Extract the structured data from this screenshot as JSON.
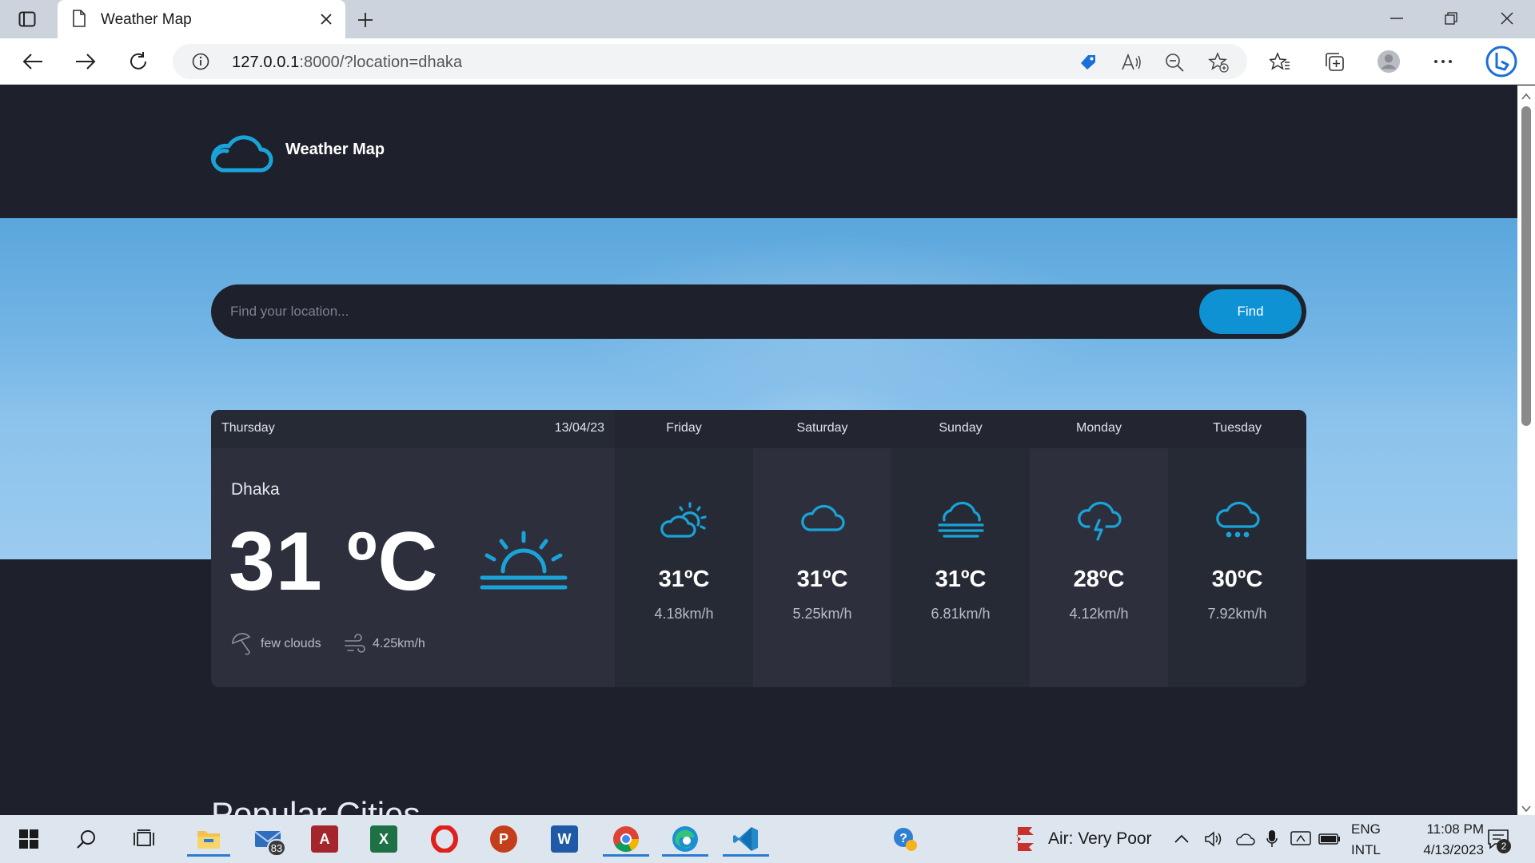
{
  "browser": {
    "tab_title": "Weather Map",
    "url_host": "127.0.0.1",
    "url_rest": ":8000/?location=dhaka",
    "icons": [
      "tab-actions-icon",
      "page-icon",
      "close-icon",
      "plus-icon",
      "minimize-icon",
      "restore-icon",
      "close-window-icon",
      "back-icon",
      "forward-icon",
      "refresh-icon",
      "info-icon",
      "coupon-tag-icon",
      "read-aloud-icon",
      "zoom-out-icon",
      "add-favorite-icon",
      "favorites-icon",
      "collections-icon",
      "profile-icon",
      "more-icon",
      "bing-icon"
    ]
  },
  "site": {
    "name": "Weather Map",
    "accent_color": "#1aa3d9"
  },
  "search": {
    "placeholder": "Find your location...",
    "button": "Find"
  },
  "today": {
    "day": "Thursday",
    "date": "13/04/23",
    "city": "Dhaka",
    "temp": "31 ºC",
    "description": "few clouds",
    "wind": "4.25km/h",
    "icon": "sunrise-icon"
  },
  "forecast": [
    {
      "day": "Friday",
      "temp": "31ºC",
      "wind": "4.18km/h",
      "icon": "partly-sunny-icon"
    },
    {
      "day": "Saturday",
      "temp": "31ºC",
      "wind": "5.25km/h",
      "icon": "cloud-icon"
    },
    {
      "day": "Sunday",
      "temp": "31ºC",
      "wind": "6.81km/h",
      "icon": "fog-icon"
    },
    {
      "day": "Monday",
      "temp": "28ºC",
      "wind": "4.12km/h",
      "icon": "thunderstorm-icon"
    },
    {
      "day": "Tuesday",
      "temp": "30ºC",
      "wind": "7.92km/h",
      "icon": "snow-icon"
    }
  ],
  "popular": {
    "title": "Popular Cities"
  },
  "taskbar": {
    "mail_badge": "83",
    "air_quality": "Air: Very Poor",
    "lang_1": "ENG",
    "lang_2": "INTL",
    "time": "11:08 PM",
    "date": "4/13/2023",
    "notification_count": "2"
  }
}
